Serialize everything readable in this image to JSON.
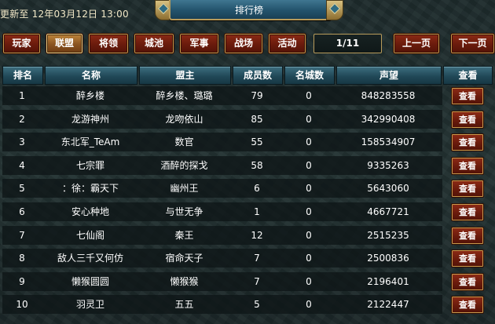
{
  "header": {
    "updated_text": "更新至 12年03月12日 13:00",
    "title": "排行榜"
  },
  "nav": {
    "tabs": [
      {
        "label": "玩家",
        "active": false
      },
      {
        "label": "联盟",
        "active": true
      },
      {
        "label": "将领",
        "active": false
      },
      {
        "label": "城池",
        "active": false
      },
      {
        "label": "军事",
        "active": false
      },
      {
        "label": "战场",
        "active": false
      },
      {
        "label": "活动",
        "active": false
      }
    ],
    "page_indicator": "1/11",
    "prev_label": "上一页",
    "next_label": "下一页"
  },
  "table": {
    "columns": [
      "排名",
      "名称",
      "盟主",
      "成员数",
      "名城数",
      "声望",
      "查看"
    ],
    "rows": [
      {
        "rank": "1",
        "name": "醉乡楼",
        "leader": "醉乡楼、璐璐",
        "members": "79",
        "cities": "0",
        "prestige": "848283558",
        "action": "查看"
      },
      {
        "rank": "2",
        "name": "龙游神州",
        "leader": "龙吻依山",
        "members": "85",
        "cities": "0",
        "prestige": "342990408",
        "action": "查看"
      },
      {
        "rank": "3",
        "name": "东北军_TeAm",
        "leader": "数官",
        "members": "55",
        "cities": "0",
        "prestige": "158534907",
        "action": "查看"
      },
      {
        "rank": "4",
        "name": "七宗罪",
        "leader": "酒醉的探戈",
        "members": "58",
        "cities": "0",
        "prestige": "9335263",
        "action": "查看"
      },
      {
        "rank": "5",
        "name": "：徐：霸天下",
        "leader": "幽州王",
        "members": "6",
        "cities": "0",
        "prestige": "5643060",
        "action": "查看"
      },
      {
        "rank": "6",
        "name": "安心种地",
        "leader": "与世无争",
        "members": "1",
        "cities": "0",
        "prestige": "4667721",
        "action": "查看"
      },
      {
        "rank": "7",
        "name": "七仙阁",
        "leader": "秦王",
        "members": "12",
        "cities": "0",
        "prestige": "2515235",
        "action": "查看"
      },
      {
        "rank": "8",
        "name": "敌人三千又何仿",
        "leader": "宿命天子",
        "members": "7",
        "cities": "0",
        "prestige": "2500836",
        "action": "查看"
      },
      {
        "rank": "9",
        "name": "懒猴圆圆",
        "leader": "懒猴猴",
        "members": "7",
        "cities": "0",
        "prestige": "2196401",
        "action": "查看"
      },
      {
        "rank": "10",
        "name": "羽灵卫",
        "leader": "五五",
        "members": "5",
        "cities": "0",
        "prestige": "2122447",
        "action": "查看"
      }
    ]
  }
}
